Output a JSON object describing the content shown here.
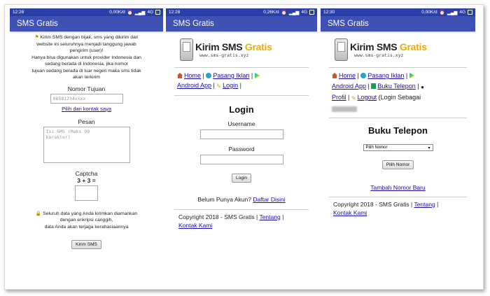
{
  "screen1": {
    "status": {
      "time": "12:28",
      "speed": "0,00K/d",
      "network": "4G"
    },
    "appbar_title": "SMS Gratis",
    "notice_lines": [
      "Kirim SMS dengan bijak, sms yang dikirim dari",
      "website ini seluruhnya menjadi tanggung jawab",
      "pengirim (user)!",
      "Hanya bisa digunakan untuk provider Indonesia dan",
      "sedang berada di Indonesia, jika nomor",
      "tujuan sedang berada di luar negeri maka sms tidak",
      "akan terkirim"
    ],
    "nomor_label": "Nomor Tujuan",
    "nomor_placeholder": "08581234xxxx",
    "contact_link": "Pilih dari kontak saya",
    "pesan_label": "Pesan",
    "pesan_placeholder_1": "Isi SMS (Maks 90",
    "pesan_placeholder_2": "karakter)",
    "captcha_label": "Captcha",
    "captcha_question": "3 + 3 =",
    "security_lines": [
      "Seluruh data yang Anda kirimkan diamankan",
      "dengan enkripsi canggih,",
      "data Anda akan terjaga kerahasiaannya"
    ],
    "send_button": "Kirim SMS"
  },
  "screen2": {
    "status": {
      "time": "12:28",
      "speed": "0,26K/d",
      "network": "4G"
    },
    "appbar_title": "SMS Gratis",
    "logo": {
      "main": "Kirim SMS",
      "accent": "Gratis",
      "sub": "www.sms-gratis.xyz"
    },
    "nav": {
      "home": "Home",
      "ads": "Pasang Iklan",
      "android": "Android App",
      "login": "Login"
    },
    "login_title": "Login",
    "username_label": "Username",
    "password_label": "Password",
    "login_button": "Login",
    "no_account": "Belum Punya Akun?",
    "register_link": "Daftar Disini",
    "copyright": "Copyright 2018 - SMS Gratis |",
    "about_link": "Tentang",
    "contact_link": "Kontak Kami"
  },
  "screen3": {
    "status": {
      "time": "12:30",
      "speed": "0,00K/d",
      "network": "4G"
    },
    "appbar_title": "SMS Gratis",
    "logo": {
      "main": "Kirim SMS",
      "accent": "Gratis",
      "sub": "www.sms-gratis.xyz"
    },
    "nav": {
      "home": "Home",
      "ads": "Pasang Iklan",
      "android": "Android App",
      "phonebook": "Buku Telepon",
      "profile": "Profil",
      "logout": "Logout",
      "logged_in_as": "(Login Sebagai"
    },
    "title": "Buku Telepon",
    "select_value": "Pilih Nomor",
    "select_button": "Pilih Nomor",
    "add_link": "Tambah Nomor Baru",
    "copyright": "Copyright 2018 - SMS Gratis |",
    "about_link": "Tentang",
    "contact_link": "Kontak Kami"
  }
}
